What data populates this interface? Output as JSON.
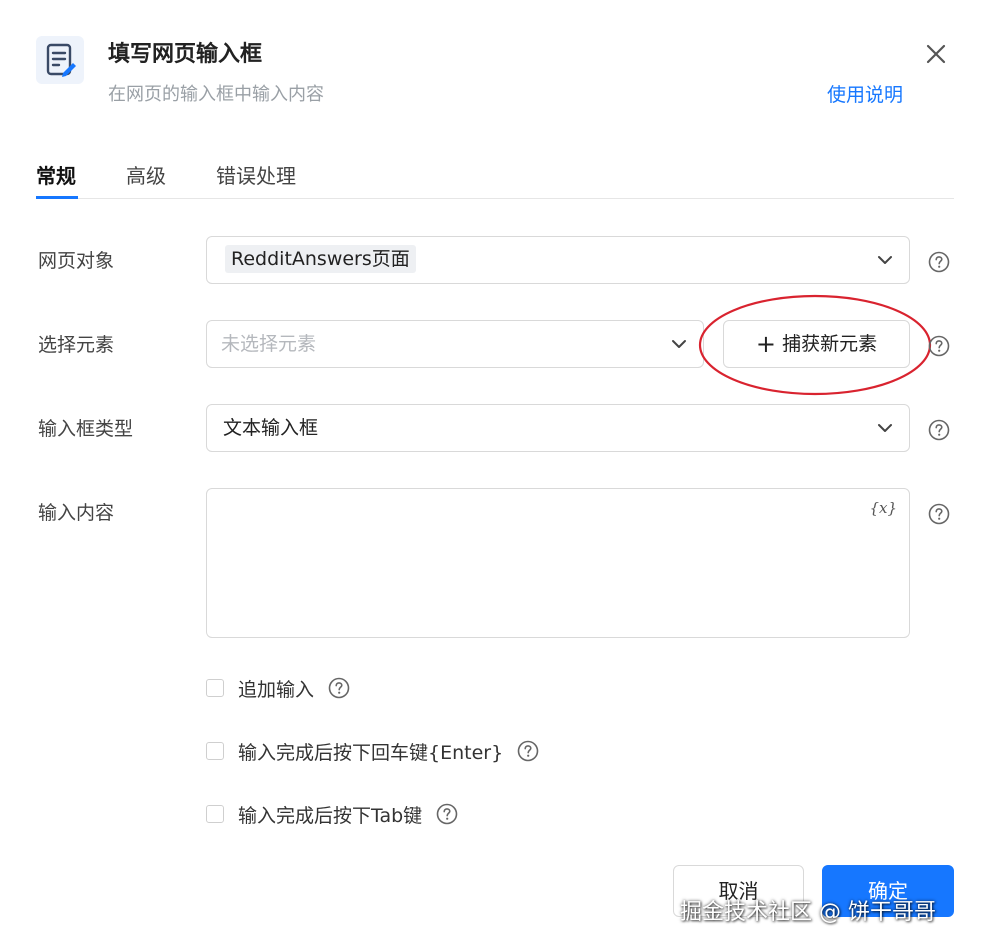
{
  "header": {
    "icon": "edit-document-icon",
    "title": "填写网页输入框",
    "subtitle": "在网页的输入框中输入内容",
    "help_link": "使用说明",
    "close_icon": "close-icon"
  },
  "tabs": [
    {
      "label": "常规",
      "active": true
    },
    {
      "label": "高级",
      "active": false
    },
    {
      "label": "错误处理",
      "active": false
    }
  ],
  "form": {
    "web_object": {
      "label": "网页对象",
      "value": "RedditAnswers页面"
    },
    "select_element": {
      "label": "选择元素",
      "placeholder": "未选择元素",
      "capture_button": "捕获新元素"
    },
    "input_type": {
      "label": "输入框类型",
      "value": "文本输入框"
    },
    "input_content": {
      "label": "输入内容",
      "value": "",
      "variable_button": "{x}"
    }
  },
  "options": [
    {
      "label": "追加输入",
      "checked": false
    },
    {
      "label": "输入完成后按下回车键{Enter}",
      "checked": false
    },
    {
      "label": "输入完成后按下Tab键",
      "checked": false
    }
  ],
  "footer": {
    "cancel": "取消",
    "confirm": "确定"
  },
  "watermark": "掘金技术社区 @ 饼干哥哥",
  "colors": {
    "accent": "#1677ff",
    "annotation": "#d9232f"
  }
}
